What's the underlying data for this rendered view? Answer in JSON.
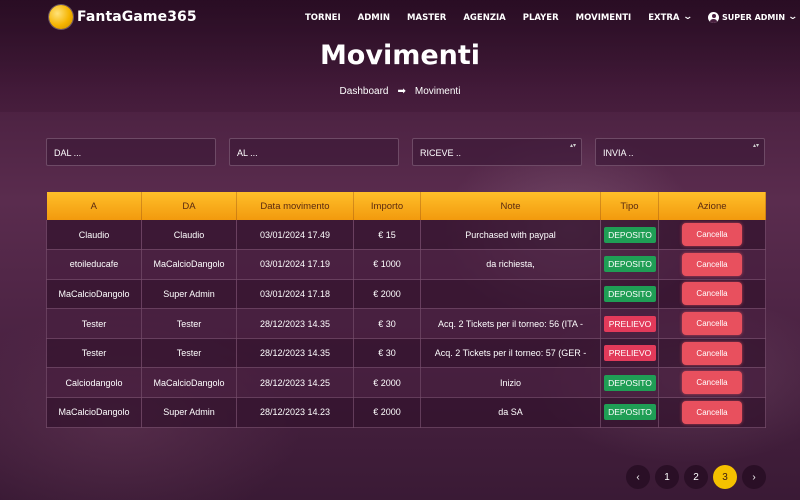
{
  "brand": {
    "name": "FantaGame365"
  },
  "nav": {
    "items": [
      "TORNEI",
      "ADMIN",
      "MASTER",
      "AGENZIA",
      "PLAYER",
      "MOVIMENTI"
    ],
    "extra_label": "EXTRA",
    "user_label": "SUPER ADMIN"
  },
  "page": {
    "title": "Movimenti",
    "breadcrumb": {
      "home": "Dashboard",
      "current": "Movimenti"
    }
  },
  "filters": {
    "dal": "DAL ...",
    "al": "AL ...",
    "riceve": "RICEVE ..",
    "invia": "INVIA .."
  },
  "table": {
    "columns": [
      "A",
      "DA",
      "Data movimento",
      "Importo",
      "Note",
      "Tipo",
      "Azione"
    ],
    "action_label": "Cancella",
    "rows": [
      {
        "a": "Claudio",
        "da": "Claudio",
        "date": "03/01/2024 17.49",
        "amount": "€ 15",
        "note": "Purchased with paypal",
        "tipo": "DEPOSITO"
      },
      {
        "a": "etoileducafe",
        "da": "MaCalcioDangolo",
        "date": "03/01/2024 17.19",
        "amount": "€ 1000",
        "note": "da richiesta,",
        "tipo": "DEPOSITO"
      },
      {
        "a": "MaCalcioDangolo",
        "da": "Super Admin",
        "date": "03/01/2024 17.18",
        "amount": "€ 2000",
        "note": "",
        "tipo": "DEPOSITO"
      },
      {
        "a": "Tester",
        "da": "Tester",
        "date": "28/12/2023 14.35",
        "amount": "€ 30",
        "note": "Acq. 2 Tickets per il torneo: 56 (ITA -",
        "tipo": "PRELIEVO"
      },
      {
        "a": "Tester",
        "da": "Tester",
        "date": "28/12/2023 14.35",
        "amount": "€ 30",
        "note": "Acq. 2 Tickets per il torneo: 57 (GER -",
        "tipo": "PRELIEVO"
      },
      {
        "a": "Calciodangolo",
        "da": "MaCalcioDangolo",
        "date": "28/12/2023 14.25",
        "amount": "€ 2000",
        "note": "Inizio",
        "tipo": "DEPOSITO"
      },
      {
        "a": "MaCalcioDangolo",
        "da": "Super Admin",
        "date": "28/12/2023 14.23",
        "amount": "€ 2000",
        "note": "da SA",
        "tipo": "DEPOSITO"
      }
    ]
  },
  "pagination": {
    "prev_icon": "chevron-left-icon",
    "next_icon": "chevron-right-icon",
    "pages": [
      "1",
      "2",
      "3"
    ],
    "current_page": "3"
  },
  "colors": {
    "accent": "#f5c100",
    "header": "#f8b01c",
    "deposito": "#1f9e55",
    "prelievo": "#e23a5a",
    "cancel": "#e8505e"
  }
}
